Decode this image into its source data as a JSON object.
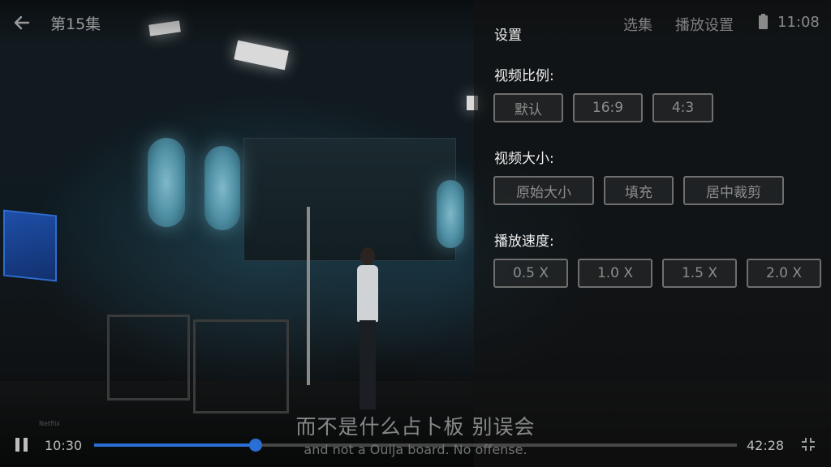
{
  "header": {
    "back_icon": "arrow-left-icon",
    "title": "第15集",
    "episodes_label": "选集",
    "playback_settings_label": "播放设置",
    "battery_icon": "battery-icon",
    "clock": "11:08"
  },
  "settings": {
    "title": "设置",
    "aspect": {
      "label": "视频比例:",
      "options": [
        "默认",
        "16:9",
        "4:3"
      ]
    },
    "size": {
      "label": "视频大小:",
      "options": [
        "原始大小",
        "填充",
        "居中裁剪"
      ]
    },
    "speed": {
      "label": "播放速度:",
      "options": [
        "0.5 X",
        "1.0 X",
        "1.5 X",
        "2.0 X"
      ]
    }
  },
  "subtitles": {
    "zh": "而不是什么占卜板  别误会",
    "en": "and not a Ouija board. No offense."
  },
  "watermark": "Netflix",
  "player": {
    "pause_icon": "pause-icon",
    "current_time": "10:30",
    "total_time": "42:28",
    "progress": 0.2513,
    "exit_fullscreen_icon": "exit-fullscreen-icon"
  },
  "colors": {
    "accent": "#2a6fd6",
    "panel_bg": "rgba(18,18,18,0.62)",
    "option_border": "#6f6f6f"
  }
}
